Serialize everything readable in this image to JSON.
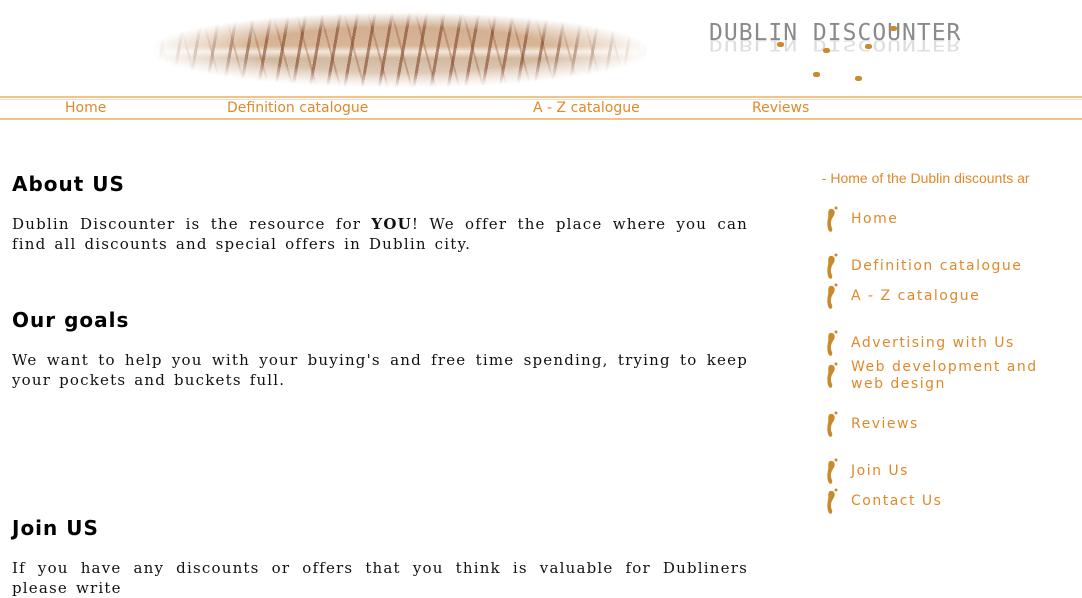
{
  "header": {
    "logo_text": "DUBLIN DISCOUNTER"
  },
  "topnav": {
    "items": [
      "Home",
      "Definition catalogue",
      "A - Z catalogue",
      "Reviews"
    ]
  },
  "content": {
    "about_heading": "About US",
    "about_pre": "Dublin Discounter is the resource for ",
    "about_bold": "YOU",
    "about_post": "! We offer the place where you can find all discounts and special offers in Dublin city.",
    "goals_heading": "Our goals",
    "goals_text": "We want to help you with your buying's and free time spending, trying to keep your pockets and buckets full.",
    "join_heading": "Join US",
    "join_text": "If you have any discounts or offers that you think is valuable for Dubliners please write"
  },
  "sidebar": {
    "marquee": "unter - Home of the Dublin discounts ar",
    "items": [
      "Home",
      "Definition catalogue",
      "A - Z catalogue",
      "Advertising with Us",
      "Web development and web design",
      "Reviews",
      "Join Us",
      "Contact Us"
    ]
  },
  "colors": {
    "accent": "#e0892b",
    "nav_border": "#f2c28d",
    "foot_icon": "#c98a2c"
  }
}
